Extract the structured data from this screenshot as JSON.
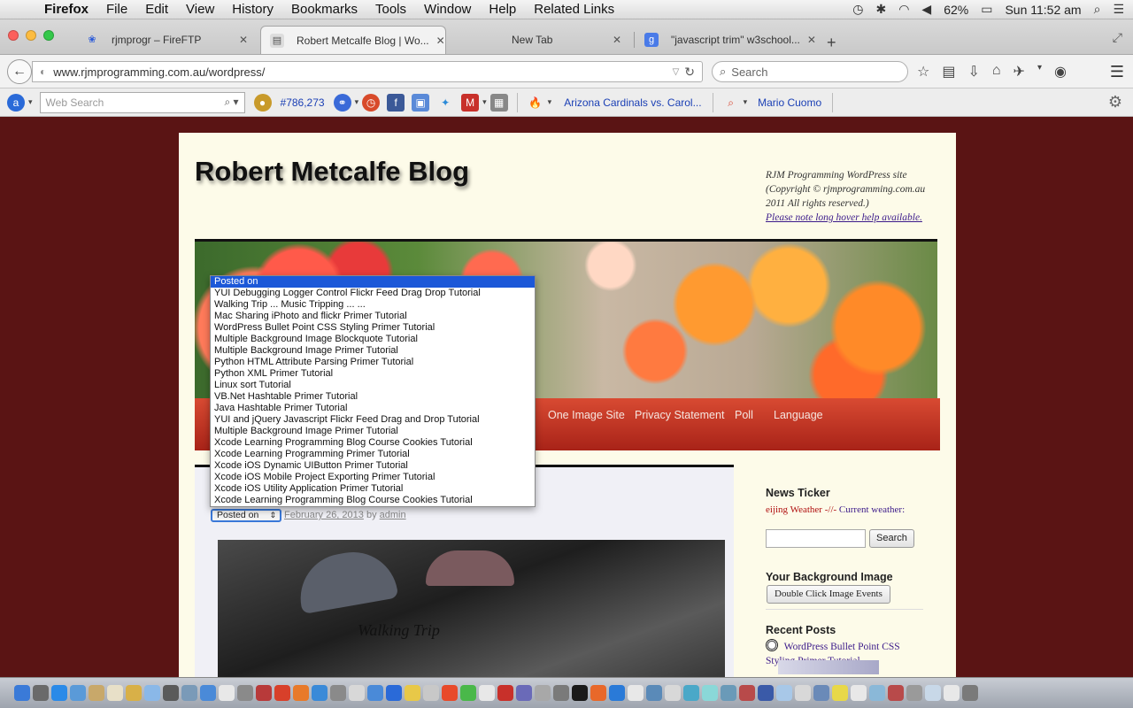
{
  "menubar": {
    "app": "Firefox",
    "items": [
      "File",
      "Edit",
      "View",
      "History",
      "Bookmarks",
      "Tools",
      "Window",
      "Help",
      "Related Links"
    ],
    "battery": "62%",
    "clock": "Sun 11:52 am"
  },
  "tabs": [
    {
      "title": "rjmprogr – FireFTP",
      "active": false
    },
    {
      "title": "Robert Metcalfe Blog | Wo...",
      "active": true
    },
    {
      "title": "New Tab",
      "active": false
    },
    {
      "title": "\"javascript trim\" w3school...",
      "active": false
    }
  ],
  "nav": {
    "url": "www.rjmprogramming.com.au/wordpress/",
    "search_placeholder": "Search"
  },
  "toolbar": {
    "web_search_placeholder": "Web Search",
    "rank": "#786,273",
    "news1": "Arizona Cardinals vs. Carol...",
    "news2": "Mario Cuomo"
  },
  "site": {
    "title": "Robert Metcalfe Blog",
    "desc_line1": "RJM Programming WordPress site",
    "desc_line2": "(Copyright © rjmprogramming.com.au 2011 All rights reserved.)",
    "hover_help": "Please note long hover help available."
  },
  "menu_items": [
    "One Image Site",
    "Privacy Statement",
    "Poll",
    "Language"
  ],
  "post": {
    "select_value": "Posted on",
    "date": "February 26, 2013",
    "by": "by",
    "author": "admin",
    "photo_caption": "Walking Trip"
  },
  "dropdown_options": [
    "Posted on",
    "YUI Debugging Logger Control Flickr Feed Drag Drop Tutorial",
    "Walking Trip ... Music Tripping ... ...",
    "Mac Sharing iPhoto and flickr Primer Tutorial",
    "WordPress Bullet Point CSS Styling Primer Tutorial",
    "Multiple Background Image Blockquote Tutorial",
    "Multiple Background Image Primer Tutorial",
    "Python HTML Attribute Parsing Primer Tutorial",
    "Python XML Primer Tutorial",
    "Linux sort Tutorial",
    "VB.Net Hashtable Primer Tutorial",
    "Java Hashtable Primer Tutorial",
    "YUI and jQuery Javascript Flickr Feed Drag and Drop Tutorial",
    "Multiple Background Image Primer Tutorial",
    "Xcode Learning Programming Blog Course Cookies Tutorial",
    "Xcode Learning Programming Primer Tutorial",
    "Xcode iOS Dynamic UIButton Primer Tutorial",
    "Xcode iOS Mobile Project Exporting Primer Tutorial",
    "Xcode iOS Utility Application Primer Tutorial",
    "Xcode Learning Programming Blog Course Cookies Tutorial"
  ],
  "sidebar": {
    "news_title": "News Ticker",
    "ticker_a": "eijing Weather -//-",
    "ticker_b": "Current weather:",
    "search_button": "Search",
    "bg_title": "Your Background Image",
    "bg_button": "Double Click Image Events",
    "recent_title": "Recent Posts",
    "recent_post": "WordPress Bullet Point CSS Styling Primer Tutorial"
  },
  "colors": {
    "page_bg": "#5a1414",
    "menu_red": "#c0331f",
    "selected_option": "#1c58d8",
    "link_purple": "#3b1a8a"
  }
}
